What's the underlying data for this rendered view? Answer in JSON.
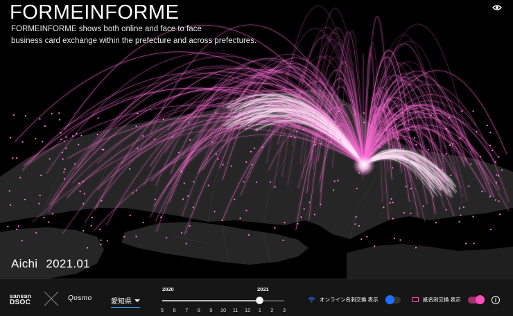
{
  "app": {
    "title": "FORMEINFORME",
    "description_line1": "FORMEINFORME shows both online and face to face",
    "description_line2": "business card exchange within the prefecture and across prefectures."
  },
  "current": {
    "region": "Aichi",
    "date": "2021.01"
  },
  "footer": {
    "logo_sansan_top": "sansan",
    "logo_sansan_bottom": "DSOC",
    "logo_qosmo": "Qosmo",
    "prefecture_select": "愛知県",
    "year_2020": "2020",
    "year_2021": "2021",
    "months": [
      "5",
      "6",
      "7",
      "8",
      "9",
      "10",
      "11",
      "12",
      "1",
      "2",
      "3"
    ],
    "selected_month_index": 8,
    "toggle_online_label": "オンライン名刺交換 表示",
    "toggle_online_on": false,
    "toggle_paper_label": "紙名刺交換 表示",
    "toggle_paper_on": true,
    "info_label": "i"
  },
  "colors": {
    "arc": "#ff6fd8",
    "arc_core": "#ffe6f8",
    "online": "#1e6fff",
    "paper": "#ff4fb8",
    "land": "#262626",
    "border": "#3a3a3a"
  },
  "icons": {
    "eye": "eye-icon",
    "wifi": "wifi-icon",
    "card": "card-icon",
    "info": "info-icon",
    "cross": "cross-icon"
  }
}
